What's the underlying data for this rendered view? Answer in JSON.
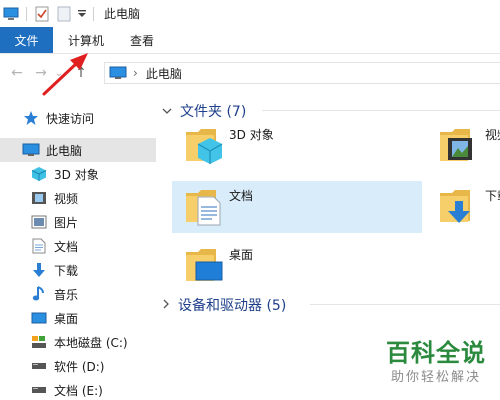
{
  "window": {
    "title": "此电脑"
  },
  "quick_access_toolbar": {
    "icons": [
      "computer-icon",
      "properties-icon",
      "new-folder-icon",
      "customize-dropdown-icon"
    ]
  },
  "ribbon": {
    "tabs": [
      {
        "label": "文件",
        "active": true
      },
      {
        "label": "计算机"
      },
      {
        "label": "查看"
      }
    ]
  },
  "nav": {
    "back": "←",
    "forward": "→",
    "recent": "⌄",
    "up": "↑"
  },
  "address": {
    "location": "此电脑",
    "separator": "›"
  },
  "sidebar": {
    "items": [
      {
        "label": "快速访问",
        "icon": "star-icon"
      },
      {
        "label": "此电脑",
        "icon": "computer-icon",
        "selected": true
      },
      {
        "label": "3D 对象",
        "icon": "cube-icon"
      },
      {
        "label": "视频",
        "icon": "film-icon"
      },
      {
        "label": "图片",
        "icon": "picture-icon"
      },
      {
        "label": "文档",
        "icon": "document-icon"
      },
      {
        "label": "下载",
        "icon": "download-arrow-icon"
      },
      {
        "label": "音乐",
        "icon": "music-note-icon"
      },
      {
        "label": "桌面",
        "icon": "desktop-icon"
      },
      {
        "label": "本地磁盘 (C:)",
        "icon": "drive-icon"
      },
      {
        "label": "软件 (D:)",
        "icon": "drive-icon"
      },
      {
        "label": "文档 (E:)",
        "icon": "drive-icon"
      }
    ]
  },
  "content": {
    "folders_group": {
      "label": "文件夹 (7)",
      "items": [
        {
          "label": "3D 对象",
          "icon": "cube-folder-icon"
        },
        {
          "label": "视频",
          "icon": "film-folder-icon"
        },
        {
          "label": "文档",
          "icon": "document-folder-icon",
          "selected": true
        },
        {
          "label": "下载",
          "icon": "download-folder-icon"
        },
        {
          "label": "桌面",
          "icon": "desktop-folder-icon"
        }
      ]
    },
    "devices_group": {
      "label": "设备和驱动器 (5)"
    }
  },
  "watermark": {
    "title": "百科全说",
    "subtitle": "助你轻松解决",
    "color": "#2b8a3e"
  },
  "colors": {
    "accent": "#1e6fbf",
    "selected_tile": "#d9ecfa",
    "selected_nav": "#e5e5e5",
    "group_header": "#1e3f8a",
    "annotation_arrow": "#e02020"
  }
}
